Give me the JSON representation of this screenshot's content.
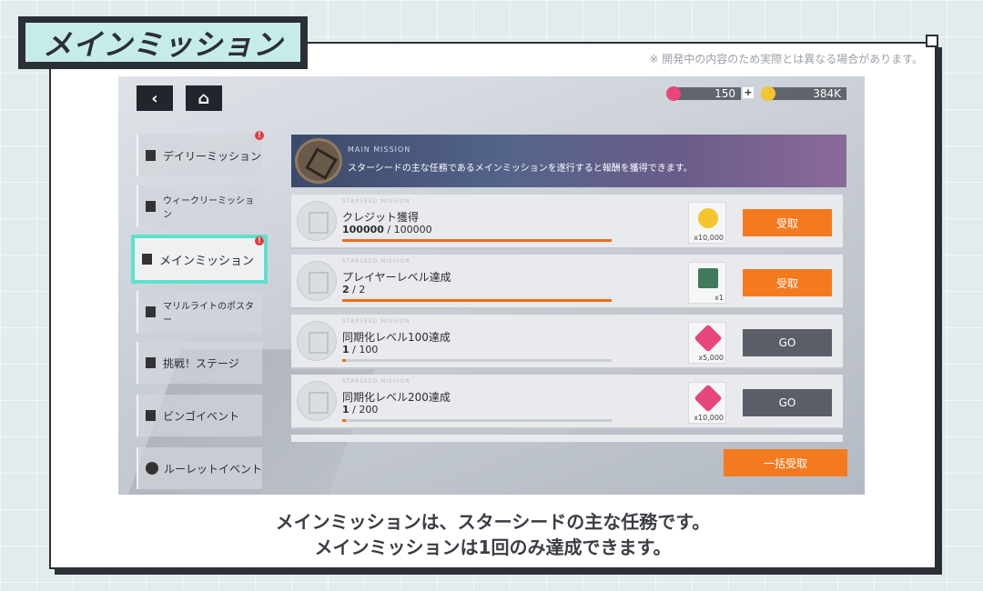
{
  "title": "メインミッション",
  "notice": "※ 開発中の内容のため実際とは異なる場合があります。",
  "caption": {
    "line1": "メインミッションは、スターシードの主な任務です。",
    "line2": "メインミッションは1回のみ達成できます。"
  },
  "topbar": {
    "back_label": "‹",
    "home_label": "⌂",
    "gems": "150",
    "plus": "+",
    "coins": "384K"
  },
  "sidebar": {
    "items": [
      {
        "label": "デイリーミッション",
        "icon": "list-icon",
        "alert": true
      },
      {
        "label": "ウィークリーミッション",
        "icon": "calendar-icon",
        "alert": false
      },
      {
        "label": "メインミッション",
        "icon": "book-icon",
        "alert": true,
        "active": true
      },
      {
        "label": "マリルライトのポスター",
        "icon": "puzzle-icon",
        "alert": false
      },
      {
        "label": "挑戦！ステージ",
        "icon": "chart-icon",
        "alert": false
      },
      {
        "label": "ビンゴイベント",
        "icon": "list-icon",
        "alert": false
      },
      {
        "label": "ルーレットイベント",
        "icon": "roulette-icon",
        "alert": false
      }
    ],
    "alert_mark": "!"
  },
  "banner": {
    "title": "MAIN MISSION",
    "description": "スターシードの主な任務であるメインミッションを遂行すると報酬を獲得できます。"
  },
  "missions": [
    {
      "tag": "STARSEED MISSION",
      "name": "クレジット獲得",
      "current": "100000",
      "total": " / 100000",
      "progress": 1.0,
      "reward_icon": "credit-coin-icon",
      "reward_qty": "x10,000",
      "reward_color": "#f2c62c",
      "action": "受取",
      "action_style": "orange"
    },
    {
      "tag": "STARSEED MISSION",
      "name": "プレイヤーレベル達成",
      "current": "2",
      "total": " / 2",
      "progress": 1.0,
      "reward_icon": "card-item-icon",
      "reward_qty": "x1",
      "reward_color": "#3f7a5a",
      "action": "受取",
      "action_style": "orange"
    },
    {
      "tag": "STARSEED MISSION",
      "name": "同期化レベル100達成",
      "current": "1",
      "total": " / 100",
      "progress": 0.01,
      "reward_icon": "gem-icon",
      "reward_qty": "x5,000",
      "reward_color": "#e8467a",
      "action": "GO",
      "action_style": "gray"
    },
    {
      "tag": "STARSEED MISSION",
      "name": "同期化レベル200達成",
      "current": "1",
      "total": " / 200",
      "progress": 0.005,
      "reward_icon": "gem-icon",
      "reward_qty": "x10,000",
      "reward_color": "#e8467a",
      "action": "GO",
      "action_style": "gray"
    }
  ],
  "bulk_claim": "一括受取",
  "colors": {
    "accent": "#f47a1f",
    "active_border": "#5fe0cf",
    "go_button": "#5b5e66"
  }
}
